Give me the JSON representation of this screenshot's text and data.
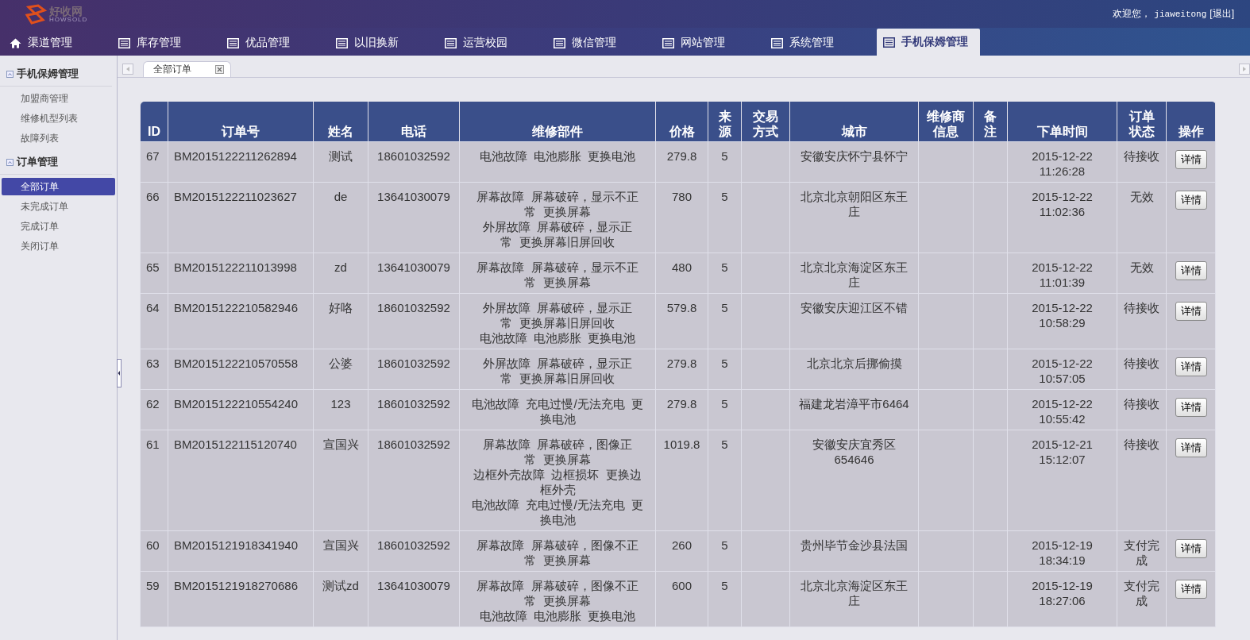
{
  "header": {
    "logo": "好收网",
    "logo_sub": "HOWSOLD",
    "welcome": "欢迎您，",
    "user": "jiaweitong",
    "logout": "[退出]"
  },
  "nav": [
    {
      "label": "渠道管理",
      "kind": "home",
      "selected": false
    },
    {
      "label": "库存管理",
      "kind": "list",
      "selected": false
    },
    {
      "label": "优品管理",
      "kind": "list",
      "selected": false
    },
    {
      "label": "以旧换新",
      "kind": "list",
      "selected": false
    },
    {
      "label": "运营校园",
      "kind": "list",
      "selected": false
    },
    {
      "label": "微信管理",
      "kind": "list",
      "selected": false
    },
    {
      "label": "网站管理",
      "kind": "list",
      "selected": false
    },
    {
      "label": "系统管理",
      "kind": "list",
      "selected": false
    },
    {
      "label": "手机保姆管理",
      "kind": "list",
      "selected": true
    }
  ],
  "sidebar": [
    {
      "title": "手机保姆管理",
      "expanded": true,
      "items": [
        {
          "label": "加盟商管理",
          "selected": false
        },
        {
          "label": "维修机型列表",
          "selected": false
        },
        {
          "label": "故障列表",
          "selected": false
        }
      ]
    },
    {
      "title": "订单管理",
      "expanded": true,
      "items": [
        {
          "label": "全部订单",
          "selected": true
        },
        {
          "label": "未完成订单",
          "selected": false
        },
        {
          "label": "完成订单",
          "selected": false
        },
        {
          "label": "关闭订单",
          "selected": false
        }
      ]
    }
  ],
  "tabs": [
    {
      "label": "全部订单",
      "selected": true
    }
  ],
  "table": {
    "columns": [
      "ID",
      "订单号",
      "姓名",
      "电话",
      "维修部件",
      "价格",
      "来源",
      "交易方式",
      "城市",
      "维修商信息",
      "备注",
      "下单时间",
      "订单状态",
      "操作"
    ],
    "rows": [
      {
        "id": "67",
        "order_no": "BM2015122211262894",
        "name": "测试",
        "phone": "18601032592",
        "parts": [
          "电池故障  电池膨胀  更换电池"
        ],
        "price": "279.8",
        "source": "5",
        "trade": "",
        "city": "安徽安庆怀宁县怀宁",
        "repairer": "",
        "note": "",
        "date": "2015-12-22",
        "time": "11:26:28",
        "status": "待接收",
        "action": "详情"
      },
      {
        "id": "66",
        "order_no": "BM2015122211023627",
        "name": "de",
        "phone": "13641030079",
        "parts": [
          "屏幕故障  屏幕破碎，显示不正",
          "常  更换屏幕",
          "外屏故障  屏幕破碎，显示正",
          "常  更换屏幕旧屏回收"
        ],
        "price": "780",
        "source": "5",
        "trade": "",
        "city": "北京北京朝阳区东王庄",
        "repairer": "",
        "note": "",
        "date": "2015-12-22",
        "time": "11:02:36",
        "status": "无效",
        "action": "详情"
      },
      {
        "id": "65",
        "order_no": "BM2015122211013998",
        "name": "zd",
        "phone": "13641030079",
        "parts": [
          "屏幕故障  屏幕破碎，显示不正",
          "常  更换屏幕"
        ],
        "price": "480",
        "source": "5",
        "trade": "",
        "city": "北京北京海淀区东王庄",
        "repairer": "",
        "note": "",
        "date": "2015-12-22",
        "time": "11:01:39",
        "status": "无效",
        "action": "详情"
      },
      {
        "id": "64",
        "order_no": "BM2015122210582946",
        "name": "好咯",
        "phone": "18601032592",
        "parts": [
          "外屏故障  屏幕破碎，显示正",
          "常  更换屏幕旧屏回收",
          "电池故障  电池膨胀  更换电池"
        ],
        "price": "579.8",
        "source": "5",
        "trade": "",
        "city": "安徽安庆迎江区不错",
        "repairer": "",
        "note": "",
        "date": "2015-12-22",
        "time": "10:58:29",
        "status": "待接收",
        "action": "详情"
      },
      {
        "id": "63",
        "order_no": "BM2015122210570558",
        "name": "公婆",
        "phone": "18601032592",
        "parts": [
          "外屏故障  屏幕破碎，显示正",
          "常  更换屏幕旧屏回收"
        ],
        "price": "279.8",
        "source": "5",
        "trade": "",
        "city": "北京北京后挪偷摸",
        "repairer": "",
        "note": "",
        "date": "2015-12-22",
        "time": "10:57:05",
        "status": "待接收",
        "action": "详情"
      },
      {
        "id": "62",
        "order_no": "BM2015122210554240",
        "name": "123",
        "phone": "18601032592",
        "parts": [
          "电池故障  充电过慢/无法充电  更",
          "换电池"
        ],
        "price": "279.8",
        "source": "5",
        "trade": "",
        "city": "福建龙岩漳平市6464",
        "repairer": "",
        "note": "",
        "date": "2015-12-22",
        "time": "10:55:42",
        "status": "待接收",
        "action": "详情"
      },
      {
        "id": "61",
        "order_no": "BM2015122115120740",
        "name": "宣国兴",
        "phone": "18601032592",
        "parts": [
          "屏幕故障  屏幕破碎，图像正",
          "常  更换屏幕",
          "边框外壳故障  边框损坏  更换边",
          "框外壳",
          "电池故障  充电过慢/无法充电  更",
          "换电池"
        ],
        "price": "1019.8",
        "source": "5",
        "trade": "",
        "city": "安徽安庆宜秀区654646",
        "repairer": "",
        "note": "",
        "date": "2015-12-21",
        "time": "15:12:07",
        "status": "待接收",
        "action": "详情"
      },
      {
        "id": "60",
        "order_no": "BM2015121918341940",
        "name": "宣国兴",
        "phone": "18601032592",
        "parts": [
          "屏幕故障  屏幕破碎，图像不正",
          "常  更换屏幕"
        ],
        "price": "260",
        "source": "5",
        "trade": "",
        "city": "贵州毕节金沙县法国",
        "repairer": "",
        "note": "",
        "date": "2015-12-19",
        "time": "18:34:19",
        "status": "支付完成",
        "action": "详情"
      },
      {
        "id": "59",
        "order_no": "BM2015121918270686",
        "name": "测试zd",
        "phone": "13641030079",
        "parts": [
          "屏幕故障  屏幕破碎，图像不正",
          "常  更换屏幕",
          "电池故障  电池膨胀  更换电池"
        ],
        "price": "600",
        "source": "5",
        "trade": "",
        "city": "北京北京海淀区东王庄",
        "repairer": "",
        "note": "",
        "date": "2015-12-19",
        "time": "18:27:06",
        "status": "支付完成",
        "action": "详情"
      }
    ]
  }
}
